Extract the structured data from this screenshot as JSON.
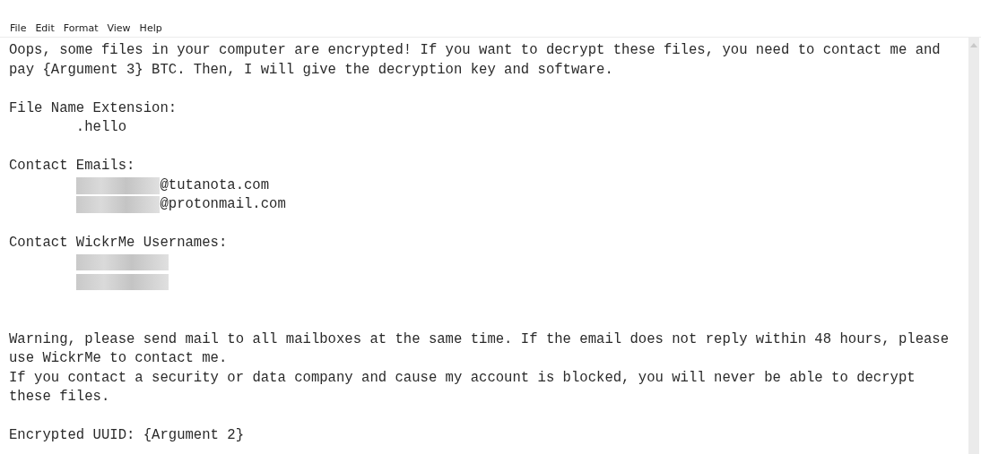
{
  "menu": [
    "File",
    "Edit",
    "Format",
    "View",
    "Help"
  ],
  "document": {
    "lines": [
      {
        "kind": "text",
        "text": "Oops, some files in your computer are encrypted! If you want to decrypt these files, you need to contact me and pay {Argument 3} BTC. Then, I will give the decryption key and software."
      },
      {
        "kind": "blank"
      },
      {
        "kind": "text",
        "text": "File Name Extension:"
      },
      {
        "kind": "indented",
        "text": ".hello"
      },
      {
        "kind": "blank"
      },
      {
        "kind": "text",
        "text": "Contact Emails:"
      },
      {
        "kind": "email",
        "text": "@tutanota.com"
      },
      {
        "kind": "email",
        "text": "@protonmail.com"
      },
      {
        "kind": "blank"
      },
      {
        "kind": "text",
        "text": "Contact WickrMe Usernames:"
      },
      {
        "kind": "redacted"
      },
      {
        "kind": "redacted"
      },
      {
        "kind": "blank"
      },
      {
        "kind": "blank"
      },
      {
        "kind": "text",
        "text": "Warning, please send mail to all mailboxes at the same time. If the email does not reply within 48 hours, please use WickrMe to contact me."
      },
      {
        "kind": "text",
        "text": "If you contact a security or data company and cause my account is blocked, you will never be able to decrypt these files."
      },
      {
        "kind": "blank"
      },
      {
        "kind": "text",
        "text": "Encrypted UUID: {Argument 2}"
      }
    ]
  }
}
